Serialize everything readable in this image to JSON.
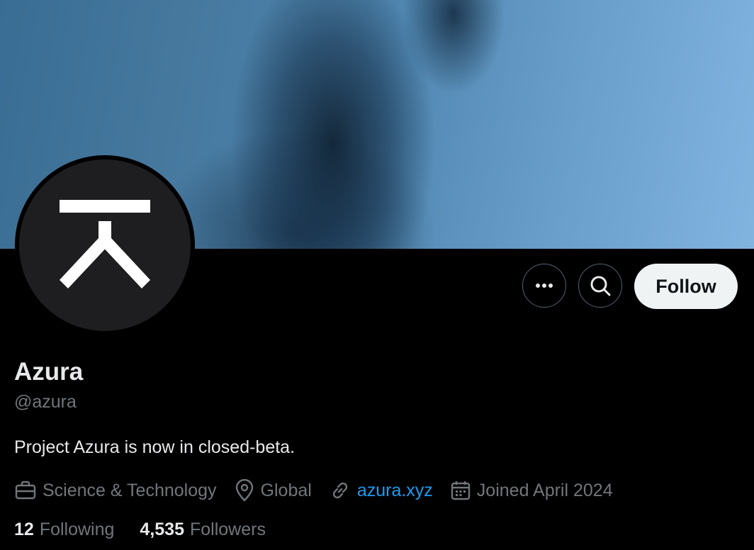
{
  "profile": {
    "name": "Azura",
    "handle": "@azura",
    "bio": "Project Azura is now in closed-beta.",
    "avatar_icon": "azura-logo-icon"
  },
  "actions": {
    "more_icon": "more-options-icon",
    "search_icon": "search-icon",
    "follow_label": "Follow"
  },
  "meta": {
    "category": "Science & Technology",
    "location": "Global",
    "website": "azura.xyz",
    "joined": "Joined April 2024"
  },
  "stats": {
    "following_count": "12",
    "following_label": "Following",
    "followers_count": "4,535",
    "followers_label": "Followers"
  },
  "colors": {
    "background": "#000000",
    "link": "#1d9bf0",
    "secondary_text": "#71767b",
    "primary_text": "#e7e9ea",
    "follow_button": "#eff3f4"
  }
}
